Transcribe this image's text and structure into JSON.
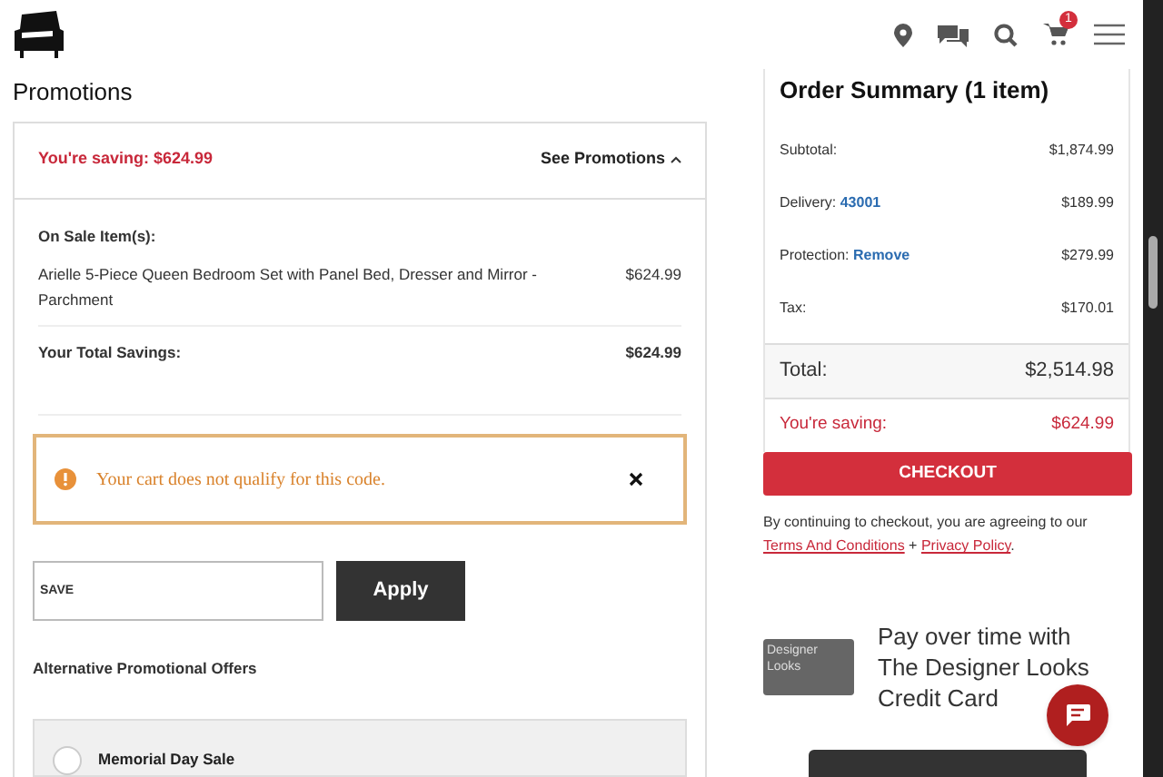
{
  "header": {
    "cart_count": "1"
  },
  "promotions": {
    "title": "Promotions",
    "saving": "You're saving: $624.99",
    "toggle": "See Promotions",
    "toggle_expanded": true,
    "on_sale_label": "On Sale Item(s):",
    "item_name": "Arielle 5-Piece Queen Bedroom Set with Panel Bed, Dresser and Mirror - Parchment",
    "item_price": "$624.99",
    "total_label": "Your Total Savings:",
    "total_value": "$624.99",
    "alert": {
      "message": "Your cart does not qualify for this code."
    },
    "code_field": {
      "value": "SAVE"
    },
    "apply_button": "Apply",
    "alternative_title": "Alternative Promotional Offers",
    "offers": [
      {
        "label": "Memorial Day Sale",
        "selected": false
      }
    ]
  },
  "order_summary": {
    "title": "Order Summary (1 item)",
    "rows": [
      {
        "label": "Subtotal:",
        "value": "$1,874.99"
      },
      {
        "label": "Delivery:",
        "link": "43001",
        "value": "$189.99"
      },
      {
        "label": "Protection:",
        "link": "Remove",
        "value": "$279.99"
      },
      {
        "label": "Tax:",
        "value": "$170.01"
      }
    ],
    "total_label": "Total:",
    "total_value": "$2,514.98",
    "saving_label": "You're saving:",
    "saving_value": "$624.99",
    "checkout_button": "CHECKOUT",
    "legal": {
      "text": "By continuing to checkout, you are agreeing to our",
      "link_1": "Terms And Conditions",
      "joiner": "+",
      "link_2": "Privacy Policy",
      "end": "."
    },
    "credit": {
      "card_label": "Designer Looks",
      "lines": [
        "Pay over time with",
        "The Designer Looks",
        "Credit Card"
      ]
    }
  }
}
